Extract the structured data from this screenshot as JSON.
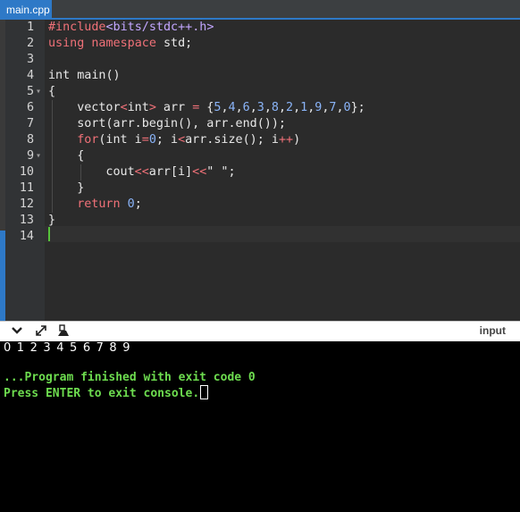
{
  "tab": {
    "label": "main.cpp"
  },
  "editor": {
    "lines": [
      {
        "n": "1",
        "fold": "",
        "indent": 0,
        "tokens": [
          {
            "t": "#include",
            "c": "#f07178"
          },
          {
            "t": "<bits/stdc++.h>",
            "c": "#c3a6ff"
          }
        ]
      },
      {
        "n": "2",
        "fold": "",
        "indent": 0,
        "tokens": [
          {
            "t": "using namespace ",
            "c": "#f07178"
          },
          {
            "t": "std;",
            "c": "#e8e8e8"
          }
        ]
      },
      {
        "n": "3",
        "fold": "",
        "indent": 0,
        "tokens": []
      },
      {
        "n": "4",
        "fold": "",
        "indent": 0,
        "tokens": [
          {
            "t": "int main()",
            "c": "#e8e8e8"
          }
        ]
      },
      {
        "n": "5",
        "fold": "▾",
        "indent": 0,
        "tokens": [
          {
            "t": "{",
            "c": "#e8e8e8"
          }
        ]
      },
      {
        "n": "6",
        "fold": "",
        "indent": 1,
        "tokens": [
          {
            "t": "vector",
            "c": "#e8e8e8"
          },
          {
            "t": "<",
            "c": "#f07178"
          },
          {
            "t": "int",
            "c": "#e8e8e8"
          },
          {
            "t": ">",
            "c": "#f07178"
          },
          {
            "t": " arr ",
            "c": "#e8e8e8"
          },
          {
            "t": "=",
            "c": "#f07178"
          },
          {
            "t": " {",
            "c": "#e8e8e8"
          },
          {
            "t": "5",
            "c": "#8ab4f8"
          },
          {
            "t": ",",
            "c": "#e8e8e8"
          },
          {
            "t": "4",
            "c": "#8ab4f8"
          },
          {
            "t": ",",
            "c": "#e8e8e8"
          },
          {
            "t": "6",
            "c": "#8ab4f8"
          },
          {
            "t": ",",
            "c": "#e8e8e8"
          },
          {
            "t": "3",
            "c": "#8ab4f8"
          },
          {
            "t": ",",
            "c": "#e8e8e8"
          },
          {
            "t": "8",
            "c": "#8ab4f8"
          },
          {
            "t": ",",
            "c": "#e8e8e8"
          },
          {
            "t": "2",
            "c": "#8ab4f8"
          },
          {
            "t": ",",
            "c": "#e8e8e8"
          },
          {
            "t": "1",
            "c": "#8ab4f8"
          },
          {
            "t": ",",
            "c": "#e8e8e8"
          },
          {
            "t": "9",
            "c": "#8ab4f8"
          },
          {
            "t": ",",
            "c": "#e8e8e8"
          },
          {
            "t": "7",
            "c": "#8ab4f8"
          },
          {
            "t": ",",
            "c": "#e8e8e8"
          },
          {
            "t": "0",
            "c": "#8ab4f8"
          },
          {
            "t": "};",
            "c": "#e8e8e8"
          }
        ]
      },
      {
        "n": "7",
        "fold": "",
        "indent": 1,
        "tokens": [
          {
            "t": "sort(arr.begin(), arr.end());",
            "c": "#e8e8e8"
          }
        ]
      },
      {
        "n": "8",
        "fold": "",
        "indent": 1,
        "tokens": [
          {
            "t": "for",
            "c": "#f07178"
          },
          {
            "t": "(int i",
            "c": "#e8e8e8"
          },
          {
            "t": "=",
            "c": "#f07178"
          },
          {
            "t": "0",
            "c": "#8ab4f8"
          },
          {
            "t": "; i",
            "c": "#e8e8e8"
          },
          {
            "t": "<",
            "c": "#f07178"
          },
          {
            "t": "arr.size(); i",
            "c": "#e8e8e8"
          },
          {
            "t": "++",
            "c": "#f07178"
          },
          {
            "t": ")",
            "c": "#e8e8e8"
          }
        ]
      },
      {
        "n": "9",
        "fold": "▾",
        "indent": 1,
        "tokens": [
          {
            "t": "{",
            "c": "#e8e8e8"
          }
        ]
      },
      {
        "n": "10",
        "fold": "",
        "indent": 2,
        "tokens": [
          {
            "t": "cout",
            "c": "#e8e8e8"
          },
          {
            "t": "<<",
            "c": "#f07178"
          },
          {
            "t": "arr[i]",
            "c": "#e8e8e8"
          },
          {
            "t": "<<",
            "c": "#f07178"
          },
          {
            "t": "\" \";",
            "c": "#e8e8e8"
          }
        ]
      },
      {
        "n": "11",
        "fold": "",
        "indent": 1,
        "tokens": [
          {
            "t": "}",
            "c": "#e8e8e8"
          }
        ]
      },
      {
        "n": "12",
        "fold": "",
        "indent": 1,
        "tokens": [
          {
            "t": "return ",
            "c": "#f07178"
          },
          {
            "t": "0",
            "c": "#8ab4f8"
          },
          {
            "t": ";",
            "c": "#e8e8e8"
          }
        ]
      },
      {
        "n": "13",
        "fold": "",
        "indent": 0,
        "tokens": [
          {
            "t": "}",
            "c": "#e8e8e8"
          }
        ]
      },
      {
        "n": "14",
        "fold": "",
        "indent": 0,
        "tokens": []
      }
    ]
  },
  "console_toolbar": {
    "icons": [
      "chevron-down-icon",
      "expand-icon",
      "clear-console-icon"
    ],
    "input_label": "input"
  },
  "console": {
    "output": "0 1 2 3 4 5 6 7 8 9",
    "finished_message": "...Program finished with exit code 0",
    "prompt": "Press ENTER to exit console."
  }
}
